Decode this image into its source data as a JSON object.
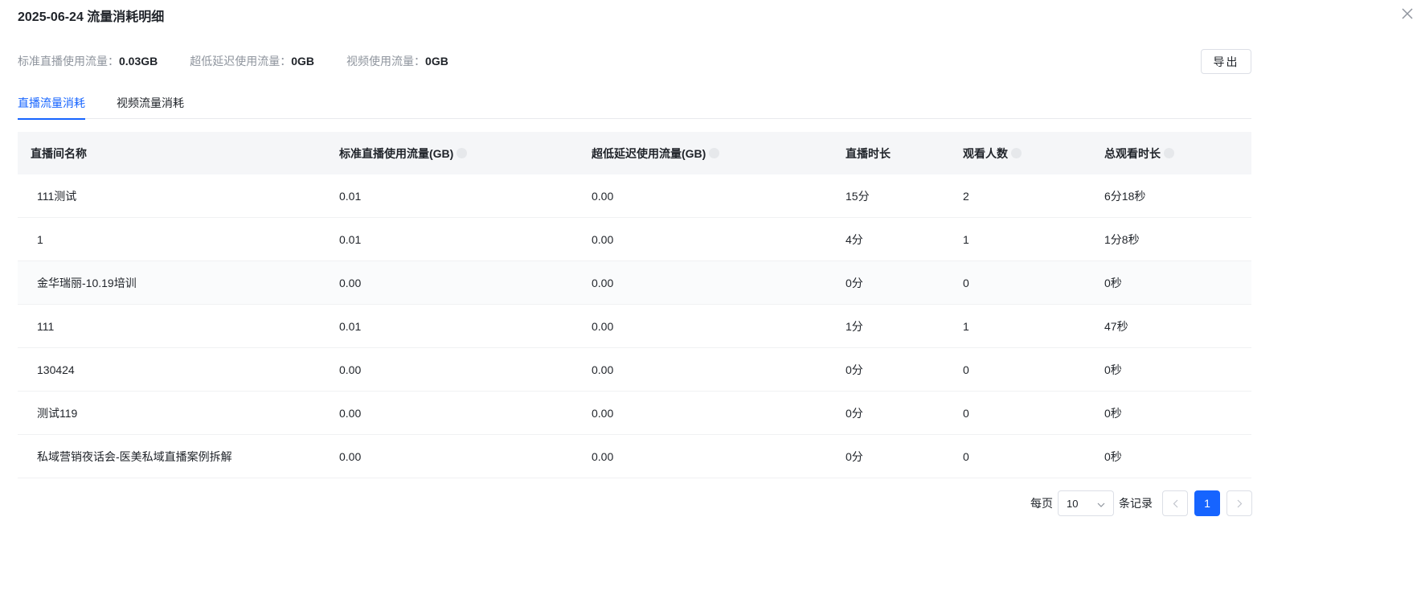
{
  "header": {
    "title": "2025-06-24 流量消耗明细"
  },
  "stats": [
    {
      "label": "标准直播使用流量：",
      "value": "0.03GB"
    },
    {
      "label": "超低延迟使用流量：",
      "value": "0GB"
    },
    {
      "label": "视频使用流量：",
      "value": "0GB"
    }
  ],
  "toolbar": {
    "export_label": "导出"
  },
  "tabs": [
    {
      "label": "直播流量消耗",
      "active": true
    },
    {
      "label": "视频流量消耗",
      "active": false
    }
  ],
  "table": {
    "columns": [
      "直播间名称",
      "标准直播使用流量(GB)",
      "超低延迟使用流量(GB)",
      "直播时长",
      "观看人数",
      "总观看时长"
    ],
    "rows": [
      [
        "111测试",
        "0.01",
        "0.00",
        "15分",
        "2",
        "6分18秒"
      ],
      [
        "1",
        "0.01",
        "0.00",
        "4分",
        "1",
        "1分8秒"
      ],
      [
        "金华瑞丽-10.19培训",
        "0.00",
        "0.00",
        "0分",
        "0",
        "0秒"
      ],
      [
        "111",
        "0.01",
        "0.00",
        "1分",
        "1",
        "47秒"
      ],
      [
        "130424",
        "0.00",
        "0.00",
        "0分",
        "0",
        "0秒"
      ],
      [
        "测试119",
        "0.00",
        "0.00",
        "0分",
        "0",
        "0秒"
      ],
      [
        "私域营销夜话会-医美私域直播案例拆解",
        "0.00",
        "0.00",
        "0分",
        "0",
        "0秒"
      ]
    ]
  },
  "pagination": {
    "per_page_label": "每页",
    "page_size": "10",
    "records_label": "条记录",
    "current_page": "1"
  },
  "colors": {
    "accent": "#1664ff",
    "header_bg": "#f5f6f8"
  }
}
